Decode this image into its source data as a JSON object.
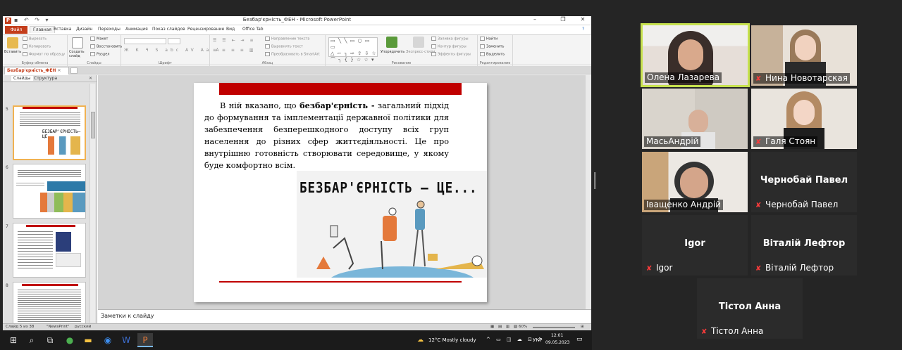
{
  "window": {
    "title": "Безбар'єрність_ФЕН - Microsoft PowerPoint",
    "app_letter": "P"
  },
  "ribbon_tabs": [
    "Файл",
    "Главная",
    "Вставка",
    "Дизайн",
    "Переходы",
    "Анимация",
    "Показ слайдов",
    "Рецензирование",
    "Вид",
    "Office Tab"
  ],
  "ribbon": {
    "clipboard": {
      "paste": "Вставить",
      "cut": "Вырезать",
      "copy": "Копировать",
      "format": "Формат по образцу",
      "group": "Буфер обмена"
    },
    "slides": {
      "new": "Создать слайд",
      "layout": "Макет",
      "reset": "Восстановить",
      "section": "Раздел",
      "group": "Слайды"
    },
    "font": {
      "group": "Шрифт"
    },
    "paragraph": {
      "direction": "Направление текста",
      "align": "Выровнять текст",
      "smartart": "Преобразовать в SmartArt",
      "group": "Абзац"
    },
    "drawing": {
      "arrange": "Упорядочить",
      "styles": "Экспресс-стили",
      "fill": "Заливка фигуры",
      "outline": "Контур фигуры",
      "effects": "Эффекты фигуры",
      "group": "Рисование"
    },
    "editing": {
      "find": "Найти",
      "replace": "Заменить",
      "select": "Выделить",
      "group": "Редактирование"
    }
  },
  "document_tab": "Безбар'єрність_ФЕН",
  "side_panel": {
    "tab_slides": "Слайды",
    "tab_outline": "Структура",
    "slide_numbers": [
      "5",
      "6",
      "7",
      "8"
    ]
  },
  "slide": {
    "text_intro": "В ній вказано, що ",
    "text_bold": "безбар'єрність -",
    "text_rest": " загальний підхід до формування та імплементації державної політики для забезпечення безперешкодного доступу всіх груп населення до різних сфер життєдіяльності. Це про внутрішню готовність створювати середовище, у якому буде комфортно всім.",
    "image_caption": "БЕЗБАР'ЄРНІСТЬ — ЦЕ..."
  },
  "notes_placeholder": "Заметки к слайду",
  "status": {
    "slide": "Слайд 5 из 38",
    "theme": "\"NewsPrint\"",
    "lang": "русский",
    "zoom": "60%"
  },
  "taskbar": {
    "weather": "12°C Mostly cloudy",
    "lang": "УКР",
    "time": "12:01",
    "date": "09.05.2023"
  },
  "participants": [
    {
      "name": "Олена Лазарева",
      "muted": false,
      "video": true,
      "active": true
    },
    {
      "name": "Нина Новотарская",
      "muted": true,
      "video": true
    },
    {
      "name": "МасьАндрій",
      "muted": false,
      "video": true
    },
    {
      "name": "Галя Стоян",
      "muted": true,
      "video": true
    },
    {
      "name": "Іващенко Андрій",
      "muted": false,
      "video": true
    },
    {
      "name": "Чернобай Павел",
      "muted": true,
      "video": false
    },
    {
      "name": "Igor",
      "muted": true,
      "video": false
    },
    {
      "name": "Віталій Лефтор",
      "muted": true,
      "video": false
    },
    {
      "name": "Тістол Анна",
      "muted": true,
      "video": false
    }
  ],
  "colors": {
    "accent": "#c43e1c",
    "slide_red": "#c00000",
    "active_speaker": "#c6e14e"
  }
}
